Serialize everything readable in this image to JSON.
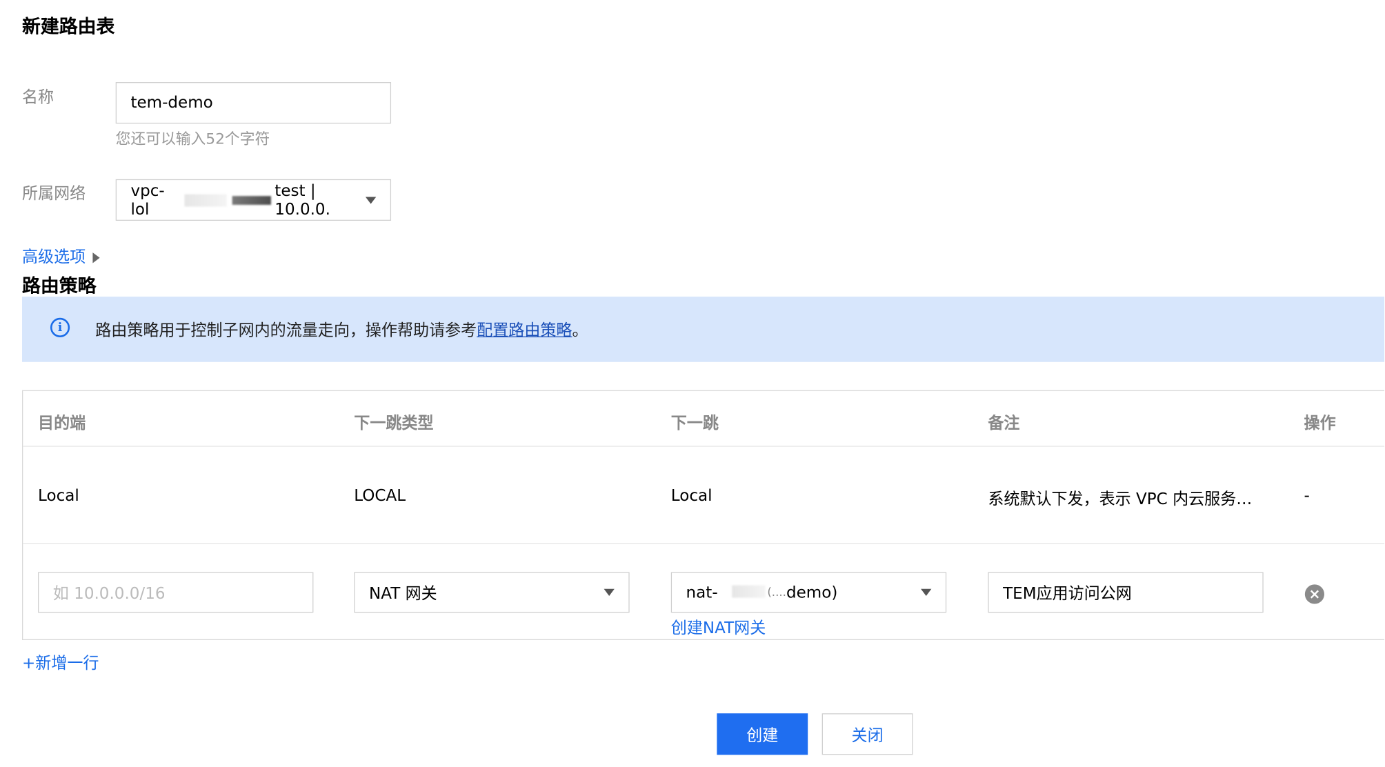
{
  "page": {
    "title": "新建路由表"
  },
  "form": {
    "name_label": "名称",
    "name_value": "tem-demo",
    "name_hint": "您还可以输入52个字符",
    "network_label": "所属网络",
    "network_value_prefix": "vpc-lol",
    "network_value_suffix": "test | 10.0.0.",
    "advanced_label": "高级选项"
  },
  "policy": {
    "section_title": "路由策略",
    "notice_text": "路由策略用于控制子网内的流量走向，操作帮助请参考",
    "notice_link": "配置路由策略",
    "notice_end": "。"
  },
  "table": {
    "headers": [
      "目的端",
      "下一跳类型",
      "下一跳",
      "备注",
      "操作"
    ],
    "row1": {
      "destination": "Local",
      "next_hop_type": "LOCAL",
      "next_hop": "Local",
      "remark": "系统默认下发，表示 VPC 内云服务…",
      "action": "-"
    },
    "row2": {
      "destination_placeholder": "如 10.0.0.0/16",
      "next_hop_type": "NAT 网关",
      "next_hop_prefix": "nat-",
      "next_hop_suffix": "demo)",
      "next_hop_mid": "(.... ",
      "create_nat_link": "创建NAT网关",
      "remark": "TEM应用访问公网"
    },
    "add_row": "+新增一行"
  },
  "buttons": {
    "create": "创建",
    "close": "关闭"
  }
}
